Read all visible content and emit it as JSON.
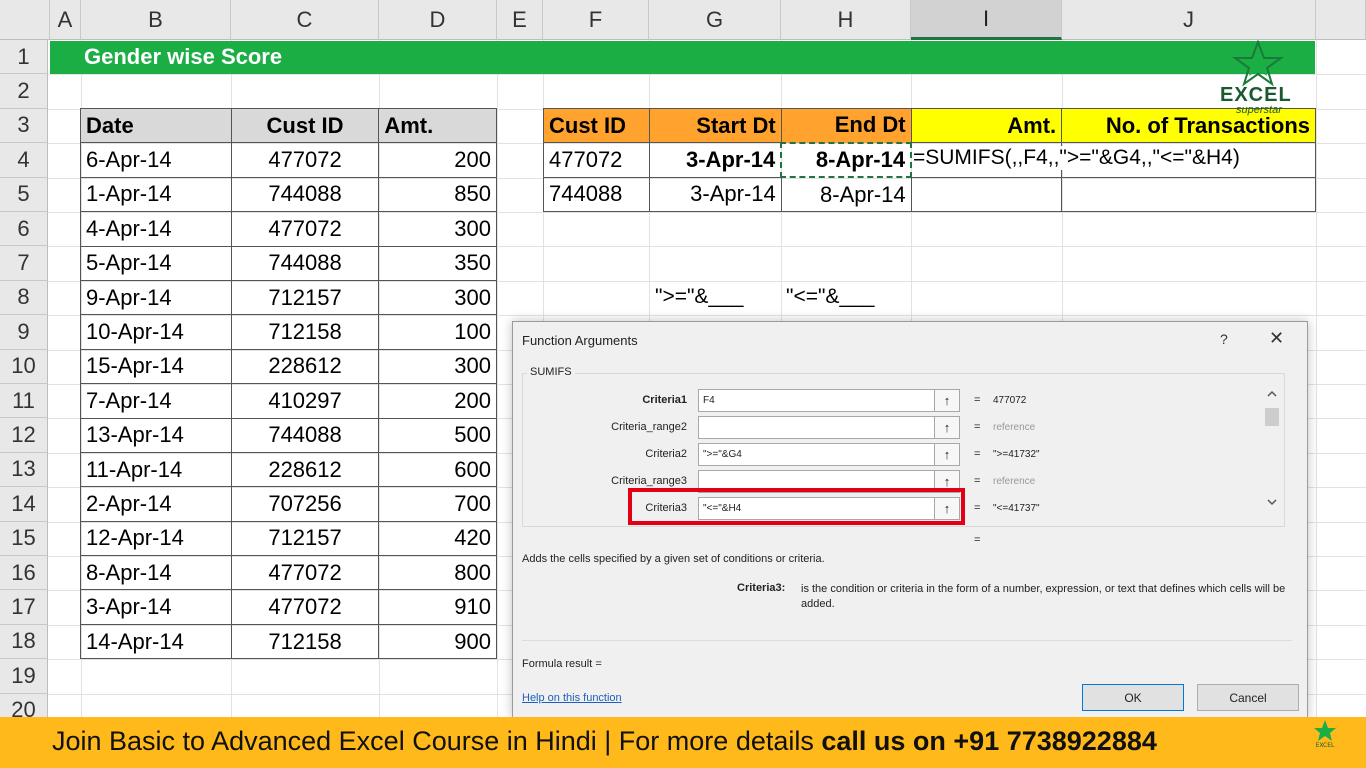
{
  "columns": [
    "A",
    "B",
    "C",
    "D",
    "E",
    "F",
    "G",
    "H",
    "I",
    "J"
  ],
  "rows": [
    "1",
    "2",
    "3",
    "4",
    "5",
    "6",
    "7",
    "8",
    "9",
    "10",
    "11",
    "12",
    "13",
    "14",
    "15",
    "16",
    "17",
    "18",
    "19",
    "20"
  ],
  "title": "Gender wise Score",
  "table": {
    "headers": [
      "Date",
      "Cust ID",
      "Amt."
    ],
    "rows": [
      [
        "6-Apr-14",
        "477072",
        "200"
      ],
      [
        "1-Apr-14",
        "744088",
        "850"
      ],
      [
        "4-Apr-14",
        "477072",
        "300"
      ],
      [
        "5-Apr-14",
        "744088",
        "350"
      ],
      [
        "9-Apr-14",
        "712157",
        "300"
      ],
      [
        "10-Apr-14",
        "712158",
        "100"
      ],
      [
        "15-Apr-14",
        "228612",
        "300"
      ],
      [
        "7-Apr-14",
        "410297",
        "200"
      ],
      [
        "13-Apr-14",
        "744088",
        "500"
      ],
      [
        "11-Apr-14",
        "228612",
        "600"
      ],
      [
        "2-Apr-14",
        "707256",
        "700"
      ],
      [
        "12-Apr-14",
        "712157",
        "420"
      ],
      [
        "8-Apr-14",
        "477072",
        "800"
      ],
      [
        "3-Apr-14",
        "477072",
        "910"
      ],
      [
        "14-Apr-14",
        "712158",
        "900"
      ]
    ]
  },
  "summary": {
    "headers": [
      "Cust ID",
      "Start Dt",
      "End Dt",
      "Amt.",
      "No. of Transactions"
    ],
    "rows": [
      [
        "477072",
        "3-Apr-14",
        "8-Apr-14"
      ],
      [
        "744088",
        "3-Apr-14",
        "8-Apr-14"
      ]
    ],
    "formula": "=SUMIFS(,,F4,,\">=\"&G4,,\"<=\"&H4)"
  },
  "hints": [
    "\">=\"&___",
    "\"<=\"&___"
  ],
  "dialog": {
    "title": "Function Arguments",
    "help_glyph": "?",
    "close_glyph": "✕",
    "function_name": "SUMIFS",
    "args": [
      {
        "label": "Criteria1",
        "value": "F4",
        "result": "477072",
        "bold": true
      },
      {
        "label": "Criteria_range2",
        "value": "",
        "result": "reference",
        "bold": false
      },
      {
        "label": "Criteria2",
        "value": "\">=\"&G4",
        "result": "\">=41732\"",
        "bold": false
      },
      {
        "label": "Criteria_range3",
        "value": "",
        "result": "reference",
        "bold": false
      },
      {
        "label": "Criteria3",
        "value": "\"<=\"&H4",
        "result": "\"<=41737\"",
        "bold": false
      }
    ],
    "equals": "=",
    "description": "Adds the cells specified by a given set of conditions or criteria.",
    "criteria_label": "Criteria3:",
    "criteria_description": "is the condition or criteria in the form of a number, expression, or text that defines which cells will be added.",
    "formula_result": "Formula result =",
    "help_link": "Help on this function",
    "ok_label": "OK",
    "cancel_label": "Cancel"
  },
  "banner": {
    "text": "Join Basic to Advanced Excel Course in Hindi | For more details ",
    "bold_text": "call us on +91 7738922884"
  },
  "logo": {
    "main": "EXCEL",
    "sub": "superstar"
  },
  "colors": {
    "green": "#1aae45",
    "orange": "#ffa32e",
    "yellow": "#ffff00",
    "banner": "#ffb91a",
    "highlight": "#e10014"
  }
}
